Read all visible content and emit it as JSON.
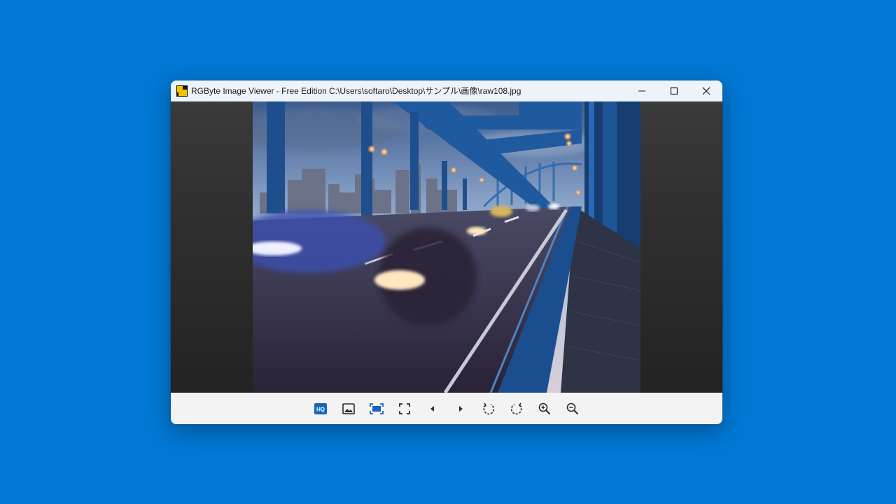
{
  "window": {
    "app_title": "RGByte Image Viewer - Free Edition",
    "file_path": "C:\\Users\\softaro\\Desktop\\サンプル\\画像\\raw108.jpg"
  },
  "titlebar_buttons": [
    {
      "name": "minimize",
      "icon": "minimize-icon"
    },
    {
      "name": "maximize",
      "icon": "maximize-icon"
    },
    {
      "name": "close",
      "icon": "close-icon"
    }
  ],
  "viewer": {
    "image": "photo of a blue steel truss bridge at dusk with motion-blurred traffic and city skyline"
  },
  "toolbar": {
    "hq_label": "HQ",
    "buttons": [
      {
        "name": "hq",
        "icon": "hq-icon",
        "active": true
      },
      {
        "name": "image",
        "icon": "image-icon"
      },
      {
        "name": "fit-to-window",
        "icon": "fit-window-icon",
        "active": true
      },
      {
        "name": "fullscreen",
        "icon": "fullscreen-icon"
      },
      {
        "name": "previous",
        "icon": "previous-icon"
      },
      {
        "name": "next",
        "icon": "next-icon"
      },
      {
        "name": "rotate-left",
        "icon": "rotate-left-icon"
      },
      {
        "name": "rotate-right",
        "icon": "rotate-right-icon"
      },
      {
        "name": "zoom-in",
        "icon": "zoom-in-icon"
      },
      {
        "name": "zoom-out",
        "icon": "zoom-out-icon"
      }
    ]
  },
  "colors": {
    "desktop": "#0078d4",
    "accent": "#1565c0",
    "icon": "#2b2b2b"
  }
}
